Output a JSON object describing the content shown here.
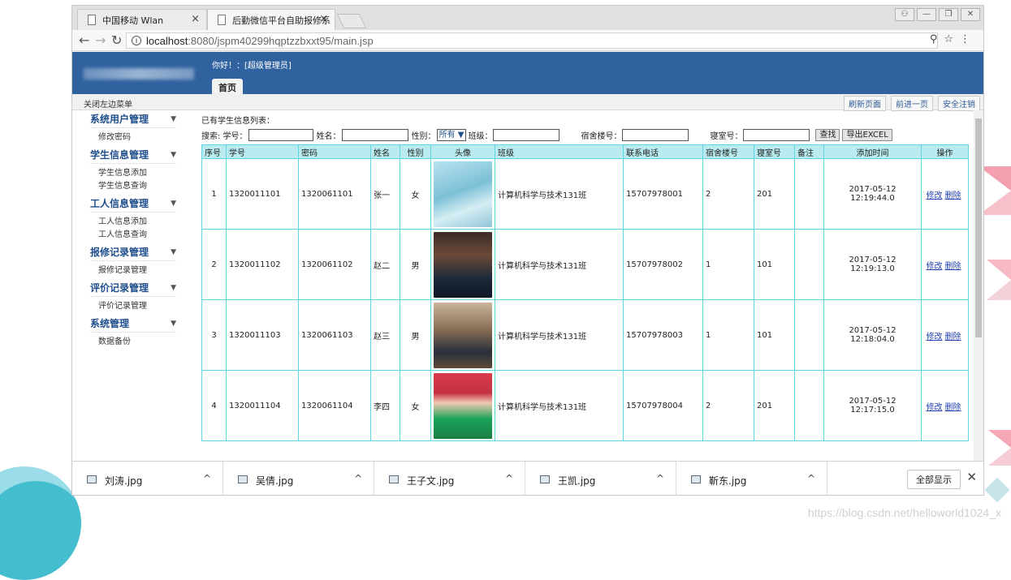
{
  "browser": {
    "tabs": [
      {
        "title": "中国移动 Wlan"
      },
      {
        "title": "后勤微信平台自助报修系"
      }
    ],
    "url_host": "localhost",
    "url_rest": ":8080/jspm40299hqptzzbxxt95/main.jsp"
  },
  "header": {
    "greeting": "你好！：[超级管理员]",
    "home_tab": "首页"
  },
  "subbar": {
    "close_menu": "关闭左边菜单",
    "refresh": "刷新页面",
    "forward": "前进一页",
    "logout": "安全注销"
  },
  "sidebar": {
    "groups": [
      {
        "title": "系统用户管理",
        "items": [
          "修改密码"
        ]
      },
      {
        "title": "学生信息管理",
        "items": [
          "学生信息添加",
          "学生信息查询"
        ]
      },
      {
        "title": "工人信息管理",
        "items": [
          "工人信息添加",
          "工人信息查询"
        ]
      },
      {
        "title": "报修记录管理",
        "items": [
          "报修记录管理"
        ]
      },
      {
        "title": "评价记录管理",
        "items": [
          "评价记录管理"
        ]
      },
      {
        "title": "系统管理",
        "items": [
          "数据备份"
        ]
      }
    ]
  },
  "content": {
    "list_title": "已有学生信息列表：",
    "search": {
      "label": "搜索: 学号：",
      "name_label": "姓名：",
      "gender_label": "性别：",
      "gender_value": "所有",
      "class_label": "班级：",
      "dorm_label": "宿舍楼号：",
      "room_label": "寝室号：",
      "find_btn": "查找",
      "export_btn": "导出EXCEL"
    },
    "columns": [
      "序号",
      "学号",
      "密码",
      "姓名",
      "性别",
      "头像",
      "班级",
      "联系电话",
      "宿舍楼号",
      "寝室号",
      "备注",
      "添加时间",
      "操作"
    ],
    "rows": [
      {
        "no": "1",
        "sid": "1320011101",
        "pwd": "1320061101",
        "name": "张一",
        "gender": "女",
        "cls": "计算机科学与技术131班",
        "phone": "15707978001",
        "dorm": "2",
        "room": "201",
        "note": "",
        "time": "2017-05-12 12:19:44.0"
      },
      {
        "no": "2",
        "sid": "1320011102",
        "pwd": "1320061102",
        "name": "赵二",
        "gender": "男",
        "cls": "计算机科学与技术131班",
        "phone": "15707978002",
        "dorm": "1",
        "room": "101",
        "note": "",
        "time": "2017-05-12 12:19:13.0"
      },
      {
        "no": "3",
        "sid": "1320011103",
        "pwd": "1320061103",
        "name": "赵三",
        "gender": "男",
        "cls": "计算机科学与技术131班",
        "phone": "15707978003",
        "dorm": "1",
        "room": "101",
        "note": "",
        "time": "2017-05-12 12:18:04.0"
      },
      {
        "no": "4",
        "sid": "1320011104",
        "pwd": "1320061104",
        "name": "李四",
        "gender": "女",
        "cls": "计算机科学与技术131班",
        "phone": "15707978004",
        "dorm": "2",
        "room": "201",
        "note": "",
        "time": "2017-05-12 12:17:15.0"
      }
    ],
    "edit_label": "修改",
    "delete_label": "删除"
  },
  "downloads": {
    "files": [
      "刘涛.jpg",
      "吴倩.jpg",
      "王子文.jpg",
      "王凯.jpg",
      "靳东.jpg"
    ],
    "show_all": "全部显示"
  },
  "watermark": "https://blog.csdn.net/helloworld1024_x"
}
